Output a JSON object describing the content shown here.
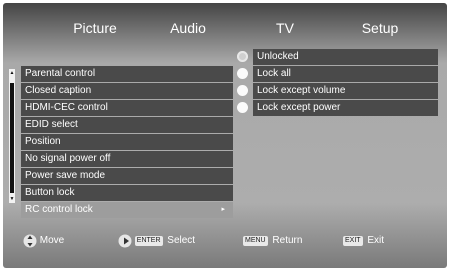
{
  "tabs": [
    "Picture",
    "Audio",
    "TV",
    "Setup"
  ],
  "menu_items": [
    {
      "label": "Parental control"
    },
    {
      "label": "Closed caption"
    },
    {
      "label": "HDMI-CEC control"
    },
    {
      "label": "EDID select"
    },
    {
      "label": "Position"
    },
    {
      "label": "No signal power off"
    },
    {
      "label": "Power save mode"
    },
    {
      "label": "Button lock"
    },
    {
      "label": "RC control lock",
      "selected": true
    }
  ],
  "options": [
    {
      "label": "Unlocked",
      "checked": true
    },
    {
      "label": "Lock all",
      "checked": false
    },
    {
      "label": "Lock except volume",
      "checked": false
    },
    {
      "label": "Lock except power",
      "checked": false
    }
  ],
  "footer": {
    "move": "Move",
    "enter_key": "ENTER",
    "select": "Select",
    "menu_key": "MENU",
    "return": "Return",
    "exit_key": "EXIT",
    "exit": "Exit"
  }
}
